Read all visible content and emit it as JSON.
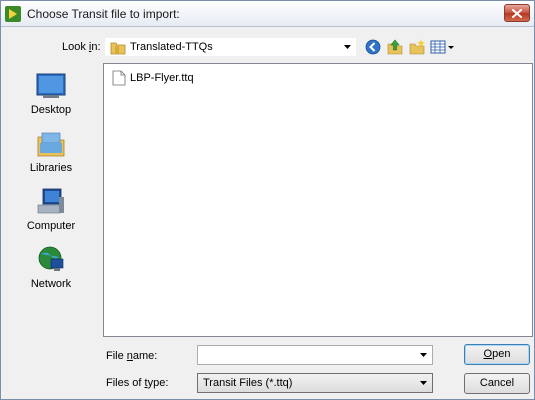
{
  "window": {
    "title": "Choose Transit file to import:",
    "close_icon": "close-icon"
  },
  "look_in": {
    "label_pre": "Look ",
    "label_key": "i",
    "label_post": "n:",
    "value": "Translated-TTQs"
  },
  "toolbar_icons": [
    "back-icon",
    "up-folder-icon",
    "new-folder-icon",
    "view-menu-icon"
  ],
  "places": [
    {
      "label": "Desktop",
      "icon": "desktop-icon"
    },
    {
      "label": "Libraries",
      "icon": "libraries-icon"
    },
    {
      "label": "Computer",
      "icon": "computer-icon"
    },
    {
      "label": "Network",
      "icon": "network-icon"
    }
  ],
  "files": [
    {
      "name": "LBP-Flyer.ttq",
      "icon": "document-icon"
    }
  ],
  "file_name": {
    "label_pre": "File ",
    "label_key": "n",
    "label_post": "ame:",
    "value": "",
    "placeholder": ""
  },
  "file_type": {
    "label_pre": "Files of ",
    "label_key": "t",
    "label_post": "ype:",
    "value": "Transit Files (*.ttq)"
  },
  "buttons": {
    "open_key": "O",
    "open_rest": "pen",
    "cancel": "Cancel"
  }
}
